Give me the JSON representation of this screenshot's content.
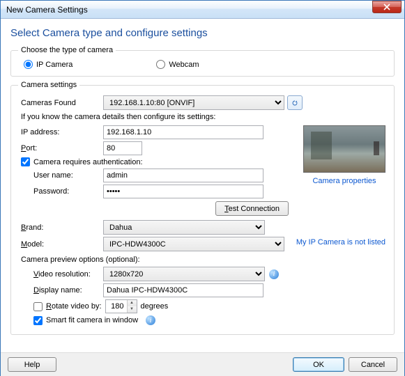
{
  "window": {
    "title": "New Camera Settings"
  },
  "heading": "Select Camera type and configure settings",
  "type_group": {
    "legend": "Choose the type of camera",
    "ip_label": "IP Camera",
    "webcam_label": "Webcam",
    "selected": "ip"
  },
  "settings": {
    "legend": "Camera settings",
    "cameras_found_label": "Cameras Found",
    "cameras_found_value": "192.168.1.10:80 [ONVIF]",
    "hint": "If you know the camera details then configure its settings:",
    "ip_label": "IP address:",
    "ip_value": "192.168.1.10",
    "port_label": "Port:",
    "port_key": "P",
    "port_value": "80",
    "auth_label": "Camera requires authentication:",
    "auth_checked": true,
    "user_label": "User name:",
    "user_value": "admin",
    "pass_label": "Password:",
    "pass_value": "•••••",
    "test_btn": "Test Connection",
    "test_key": "T",
    "brand_label": "Brand:",
    "brand_key": "B",
    "brand_value": "Dahua",
    "model_label": "Model:",
    "model_key": "M",
    "model_value": "IPC-HDW4300C",
    "preview_heading": "Camera preview options (optional):",
    "vres_label": "Video resolution:",
    "vres_key": "V",
    "vres_value": "1280x720",
    "dname_label": "Display name:",
    "dname_key": "D",
    "dname_value": "Dahua IPC-HDW4300C",
    "rotate_label": "Rotate video by:",
    "rotate_key": "R",
    "rotate_value": "180",
    "rotate_suffix": "degrees",
    "rotate_checked": false,
    "smartfit_label": "Smart fit camera in window",
    "smartfit_checked": true,
    "camera_props_link": "Camera properties",
    "not_listed_link": "My IP Camera is not listed"
  },
  "buttons": {
    "help": "Help",
    "ok": "OK",
    "cancel": "Cancel"
  }
}
